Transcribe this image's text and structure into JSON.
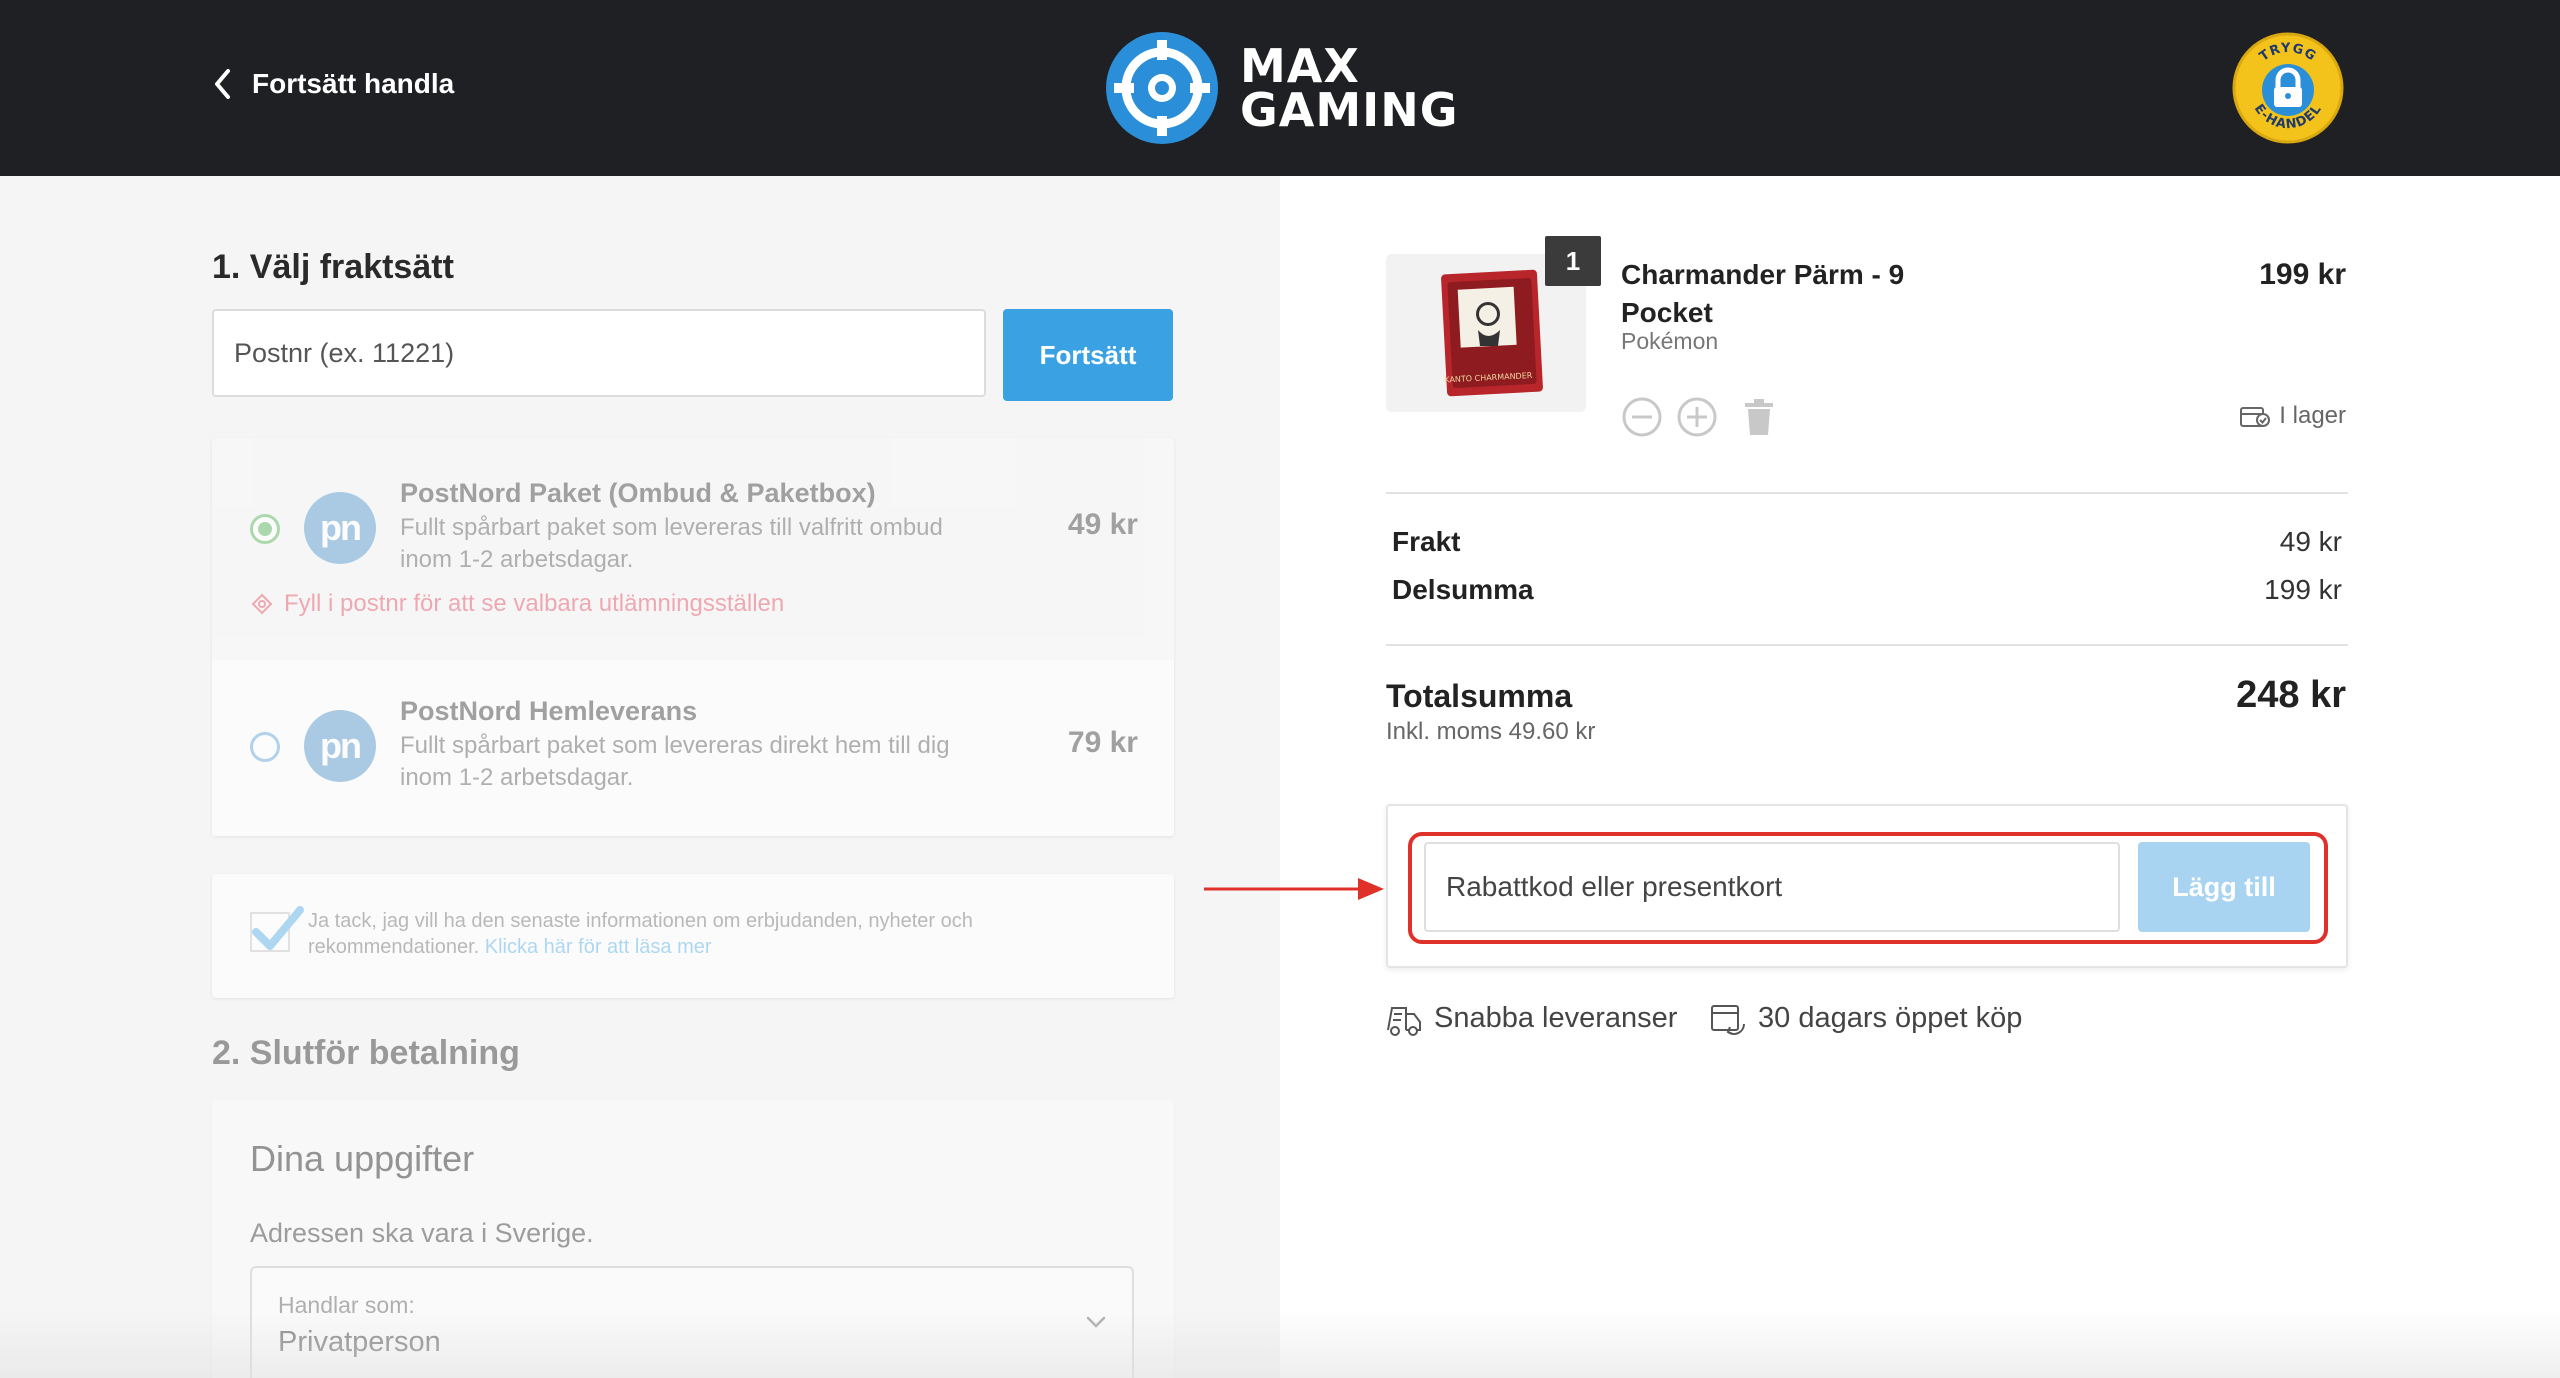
{
  "header": {
    "back_label": "Fortsätt handla",
    "logo_line1": "MAX",
    "logo_line2": "GAMING",
    "badge_top": "TRYGG",
    "badge_bottom": "E-HANDEL"
  },
  "shipping": {
    "section_title": "1. Välj fraktsätt",
    "postal_placeholder": "Postnr (ex. 11221)",
    "continue_label": "Fortsätt",
    "options": [
      {
        "logo": "pn",
        "title": "PostNord Paket (Ombud & Paketbox)",
        "description": "Fullt spårbart paket som levereras till valfritt ombud inom 1-2 arbetsdagar.",
        "price": "49 kr",
        "note": "Fyll i postnr för att se valbara utlämningsställen",
        "selected": true
      },
      {
        "logo": "pn",
        "title": "PostNord Hemleverans",
        "description": "Fullt spårbart paket som levereras direkt hem till dig inom 1-2 arbetsdagar.",
        "price": "79 kr",
        "selected": false
      }
    ]
  },
  "newsletter": {
    "text": "Ja tack, jag vill ha den senaste informationen om erbjudanden, nyheter och rekommendationer.",
    "link_text": "Klicka här för att läsa mer",
    "checked": true
  },
  "payment": {
    "section_title": "2. Slutför betalning",
    "card_title": "Dina uppgifter",
    "address_note": "Adressen ska vara i Sverige.",
    "customer_type_label": "Handlar som:",
    "customer_type_value": "Privatperson"
  },
  "cart": {
    "item": {
      "quantity": "1",
      "name": "Charmander Pärm - 9 Pocket",
      "brand": "Pokémon",
      "price": "199 kr",
      "stock": "I lager",
      "image_text": "KANTO CHARMANDER"
    },
    "frakt_label": "Frakt",
    "frakt_value": "49 kr",
    "subtotal_label": "Delsumma",
    "subtotal_value": "199 kr",
    "total_label": "Totalsumma",
    "total_value": "248 kr",
    "vat_text": "Inkl. moms 49.60 kr"
  },
  "coupon": {
    "placeholder": "Rabattkod eller presentkort",
    "button_label": "Lägg till"
  },
  "perks": [
    {
      "icon": "truck-icon",
      "label": "Snabba leveranser"
    },
    {
      "icon": "return-icon",
      "label": "30 dagars öppet köp"
    }
  ],
  "colors": {
    "header_bg": "#1f2023",
    "accent_blue": "#3aa2e3",
    "highlight_red": "#e0302a",
    "badge_yellow": "#f3c21b"
  }
}
